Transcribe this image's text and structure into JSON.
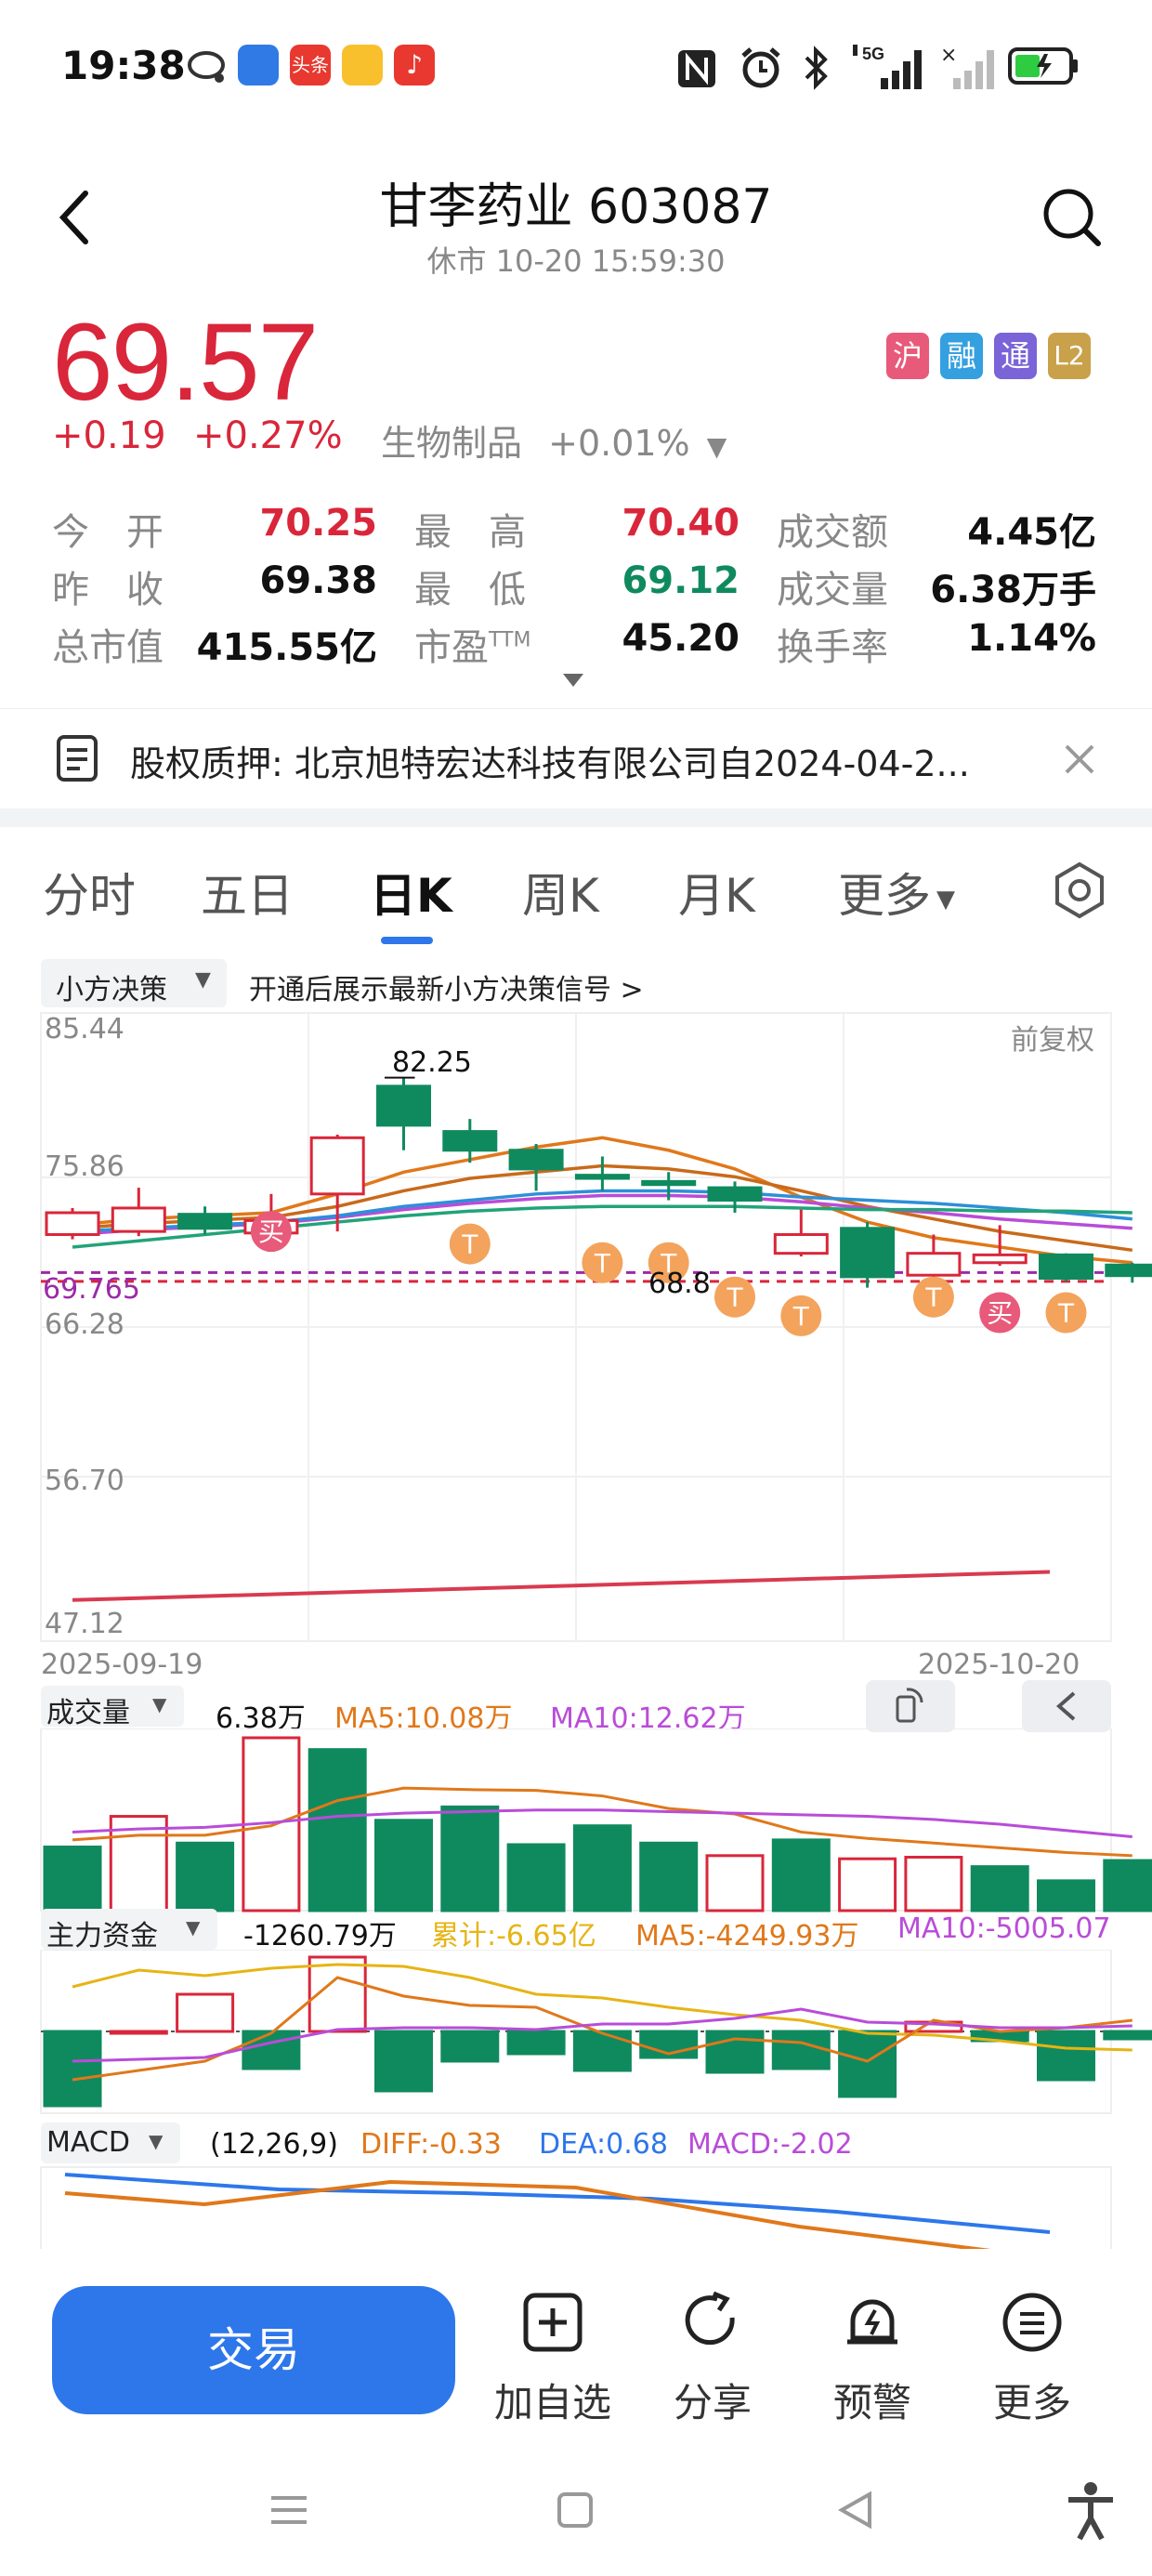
{
  "status": {
    "time": "19:38",
    "net": "5G"
  },
  "header": {
    "title": "甘李药业 603087",
    "subtitle": "休市 10-20 15:59:30"
  },
  "quote": {
    "price": "69.57",
    "change": "+0.19",
    "change_pct": "+0.27%",
    "sector": "生物制品",
    "sector_pct": "+0.01%",
    "badges": [
      "沪",
      "融",
      "通",
      "L2"
    ],
    "fields": [
      {
        "label": "今　开",
        "value": "70.25",
        "color": "red"
      },
      {
        "label": "最　高",
        "value": "70.40",
        "color": "red"
      },
      {
        "label": "成交额",
        "value": "4.45亿",
        "color": "black"
      },
      {
        "label": "昨　收",
        "value": "69.38",
        "color": "black"
      },
      {
        "label": "最　低",
        "value": "69.12",
        "color": "green"
      },
      {
        "label": "成交量",
        "value": "6.38万手",
        "color": "black"
      },
      {
        "label": "总市值",
        "value": "415.55亿",
        "color": "black"
      },
      {
        "label": "市盈",
        "value": "45.20",
        "color": "black",
        "sup": "TTM"
      },
      {
        "label": "换手率",
        "value": "1.14%",
        "color": "black"
      }
    ]
  },
  "notice": {
    "text": "股权质押: 北京旭特宏达科技有限公司自2024-04-2..."
  },
  "tabs": [
    "分时",
    "五日",
    "日K",
    "周K",
    "月K",
    "更多"
  ],
  "active_tab": 2,
  "strategy": {
    "dropdown": "小方决策",
    "promo": "开通后展示最新小方决策信号 >"
  },
  "kchart": {
    "yticks": [
      "85.44",
      "75.86",
      "66.28",
      "56.70",
      "47.12"
    ],
    "adjust": "前复权",
    "last_price_label": "69.765",
    "high_label": "82.25",
    "low_label": "68.8",
    "date_start": "2025-09-19",
    "date_end": "2025-10-20"
  },
  "volume_panel": {
    "title": "成交量",
    "value": "6.38万",
    "ma5": "MA5:10.08万",
    "ma10": "MA10:12.62万"
  },
  "fund_panel": {
    "title": "主力资金",
    "value": "-1260.79万",
    "cum": "累计:-6.65亿",
    "ma5": "MA5:-4249.93万",
    "ma10": "MA10:-5005.07"
  },
  "macd_panel": {
    "title": "MACD",
    "params": "(12,26,9)",
    "diff": "DIFF:-0.33",
    "dea": "DEA:0.68",
    "macd": "MACD:-2.02"
  },
  "bottom": {
    "trade": "交易",
    "items": [
      "加自选",
      "分享",
      "预警",
      "更多"
    ]
  },
  "colors": {
    "up": "#d9263a",
    "down": "#0f8a5f",
    "accent": "#2d77ea"
  },
  "chart_data": {
    "type": "candlestick",
    "dates": [
      "2025-09-19",
      "2025-10-20"
    ],
    "candles": [
      {
        "o": 72.2,
        "c": 73.6,
        "h": 73.9,
        "l": 71.9
      },
      {
        "o": 72.4,
        "c": 73.9,
        "h": 75.2,
        "l": 72.1
      },
      {
        "o": 73.5,
        "c": 72.6,
        "h": 74.0,
        "l": 72.2
      },
      {
        "o": 72.3,
        "c": 73.1,
        "h": 74.8,
        "l": 71.8
      },
      {
        "o": 74.8,
        "c": 78.4,
        "h": 78.6,
        "l": 72.4
      },
      {
        "o": 81.7,
        "c": 79.2,
        "h": 82.25,
        "l": 77.6
      },
      {
        "o": 78.8,
        "c": 77.6,
        "h": 79.6,
        "l": 76.8
      },
      {
        "o": 77.6,
        "c": 76.4,
        "h": 78.0,
        "l": 75.0
      },
      {
        "o": 76.0,
        "c": 75.8,
        "h": 77.2,
        "l": 75.0
      },
      {
        "o": 75.6,
        "c": 75.4,
        "h": 76.2,
        "l": 74.4
      },
      {
        "o": 75.2,
        "c": 74.4,
        "h": 75.6,
        "l": 73.6
      },
      {
        "o": 71.0,
        "c": 72.2,
        "h": 73.8,
        "l": 70.8
      },
      {
        "o": 72.6,
        "c": 69.5,
        "h": 73.0,
        "l": 68.8
      },
      {
        "o": 69.6,
        "c": 71.0,
        "h": 72.2,
        "l": 69.4
      },
      {
        "o": 70.4,
        "c": 70.9,
        "h": 72.8,
        "l": 70.2
      },
      {
        "o": 70.9,
        "c": 69.4,
        "h": 71.0,
        "l": 69.2
      },
      {
        "o": 70.25,
        "c": 69.57,
        "h": 70.4,
        "l": 69.12
      }
    ],
    "volume": [
      {
        "v": 8.1,
        "up": false
      },
      {
        "v": 12.0,
        "up": true
      },
      {
        "v": 8.6,
        "up": false
      },
      {
        "v": 22.0,
        "up": true
      },
      {
        "v": 20.5,
        "up": false
      },
      {
        "v": 11.5,
        "up": false
      },
      {
        "v": 13.2,
        "up": false
      },
      {
        "v": 8.4,
        "up": false
      },
      {
        "v": 10.8,
        "up": false
      },
      {
        "v": 8.6,
        "up": false
      },
      {
        "v": 7.0,
        "up": true
      },
      {
        "v": 9.0,
        "up": false
      },
      {
        "v": 6.6,
        "up": true
      },
      {
        "v": 6.8,
        "up": true
      },
      {
        "v": 5.6,
        "up": false
      },
      {
        "v": 3.8,
        "up": false
      },
      {
        "v": 6.38,
        "up": false
      }
    ]
  }
}
